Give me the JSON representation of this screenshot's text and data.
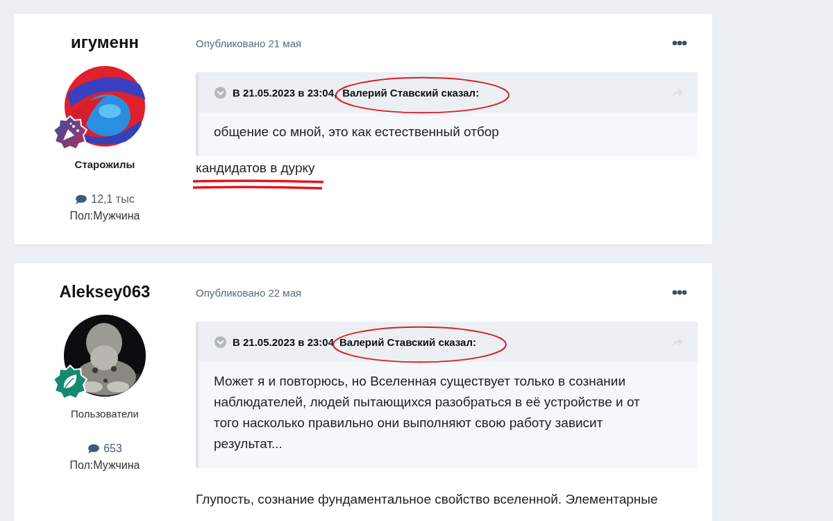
{
  "posts": [
    {
      "author": {
        "name": "игуменн",
        "group": "Старожилы",
        "group_bold": true,
        "posts_count": "12,1 тыс",
        "gender": "Пол:Мужчина"
      },
      "published": "Опубликовано 21 мая",
      "quote": {
        "date": "В 21.05.2023 в 23:04,",
        "author": "Валерий Ставский сказал:",
        "circled": true,
        "lines": [
          "общение со мной, это как естественный отбор"
        ]
      },
      "body": [
        {
          "text": "кандидатов в дурку",
          "underlined": true
        }
      ]
    },
    {
      "author": {
        "name": "Aleksey063",
        "group": "Пользователи",
        "group_bold": false,
        "posts_count": "653",
        "gender": "Пол:Мужчина"
      },
      "published": "Опубликовано 22 мая",
      "quote": {
        "date": "В 21.05.2023 в 23:04",
        "author": "Валерий Ставский сказал:",
        "circled": true,
        "lines": [
          "Может я и повторюсь, но Вселенная существует только в сознании наблюдателей, людей пытающихся разобраться в её устройстве и от того насколько правильно они выполняют свою работу зависит результат..."
        ]
      },
      "body": [
        {
          "text": "Глупость, сознание фундаментальное свойство вселенной. Элементарные",
          "underlined": false
        }
      ]
    }
  ]
}
